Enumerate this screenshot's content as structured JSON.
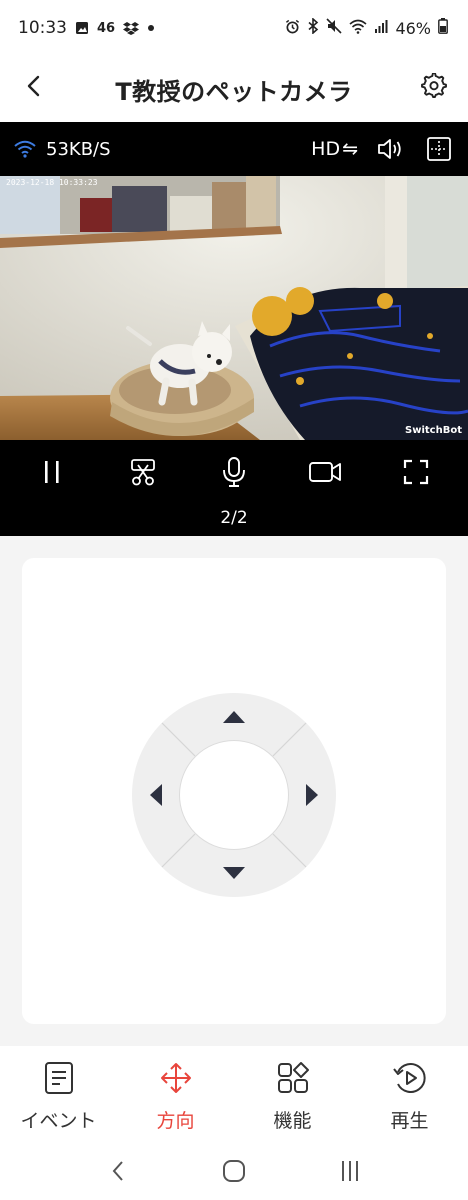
{
  "status_bar": {
    "time": "10:33",
    "network": "46",
    "battery": "46%",
    "icons": [
      "image-icon",
      "dropbox-icon",
      "dot-icon",
      "alarm-icon",
      "bluetooth-icon",
      "mute-icon",
      "wifi-icon",
      "signal-icon",
      "battery-icon"
    ]
  },
  "header": {
    "title": "T教授のペットカメラ"
  },
  "video": {
    "speed": "53KB/S",
    "quality_label": "HD",
    "quality_swap_icon": "⇋",
    "timestamp": "2023-12-18 10:33:23",
    "watermark": "SwitchBot",
    "page_indicator": "2/2",
    "controls": [
      "pause-icon",
      "screenshot-icon",
      "microphone-icon",
      "record-icon",
      "fullscreen-icon"
    ]
  },
  "tabs": [
    {
      "label": "イベント",
      "icon": "event-list-icon",
      "active": false
    },
    {
      "label": "方向",
      "icon": "move-arrows-icon",
      "active": true
    },
    {
      "label": "機能",
      "icon": "features-grid-icon",
      "active": false
    },
    {
      "label": "再生",
      "icon": "playback-icon",
      "active": false
    }
  ],
  "colors": {
    "accent": "#e8453c",
    "wifi": "#3d7be0",
    "video_bg": "#000000"
  }
}
